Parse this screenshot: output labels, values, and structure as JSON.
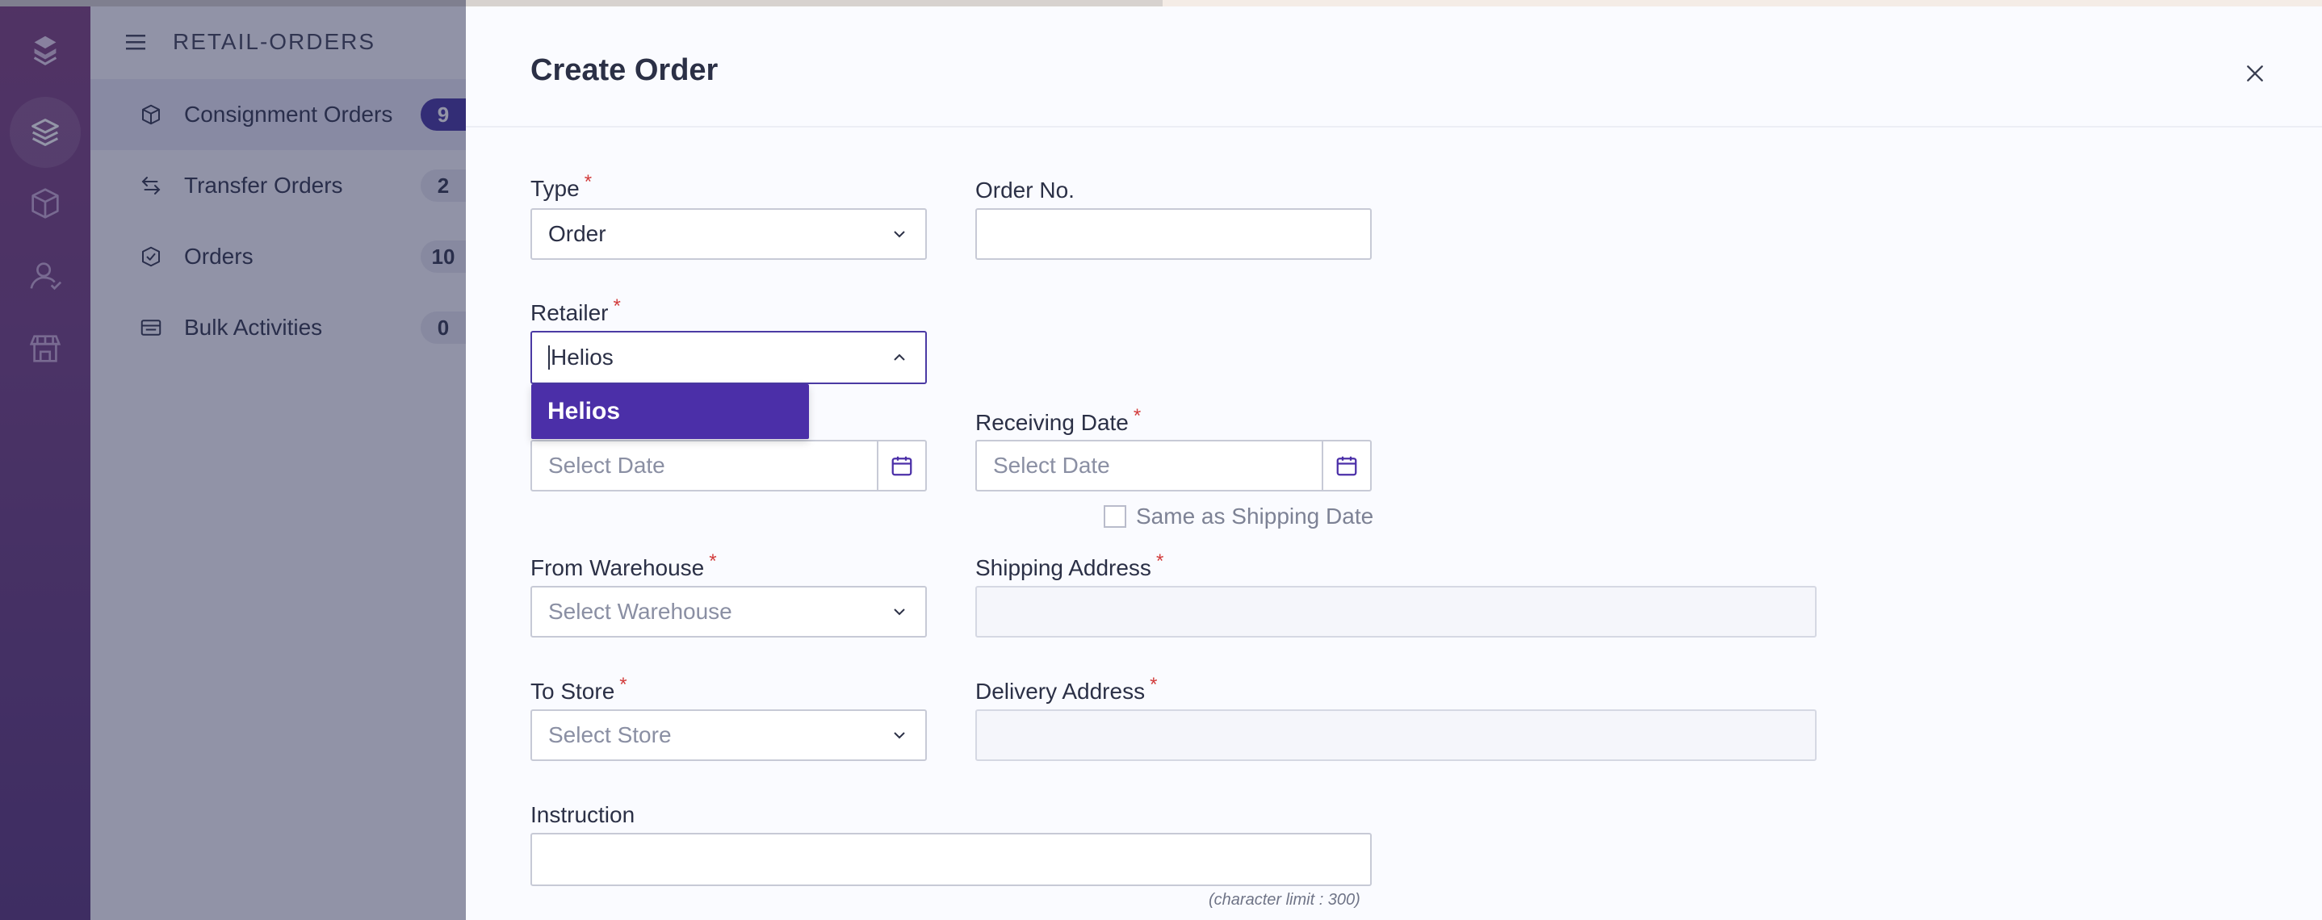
{
  "app": {
    "title": "RETAIL-ORDERS"
  },
  "sidebar": {
    "items": [
      {
        "label": "Consignment Orders",
        "count": "9",
        "icon": "cube-icon",
        "active": true
      },
      {
        "label": "Transfer Orders",
        "count": "2",
        "icon": "transfer-icon"
      },
      {
        "label": "Orders",
        "count": "10",
        "icon": "check-shield-icon"
      },
      {
        "label": "Bulk Activities",
        "count": "0",
        "icon": "list-icon"
      }
    ]
  },
  "rail": {
    "icons": [
      "logo-icon",
      "layers-icon",
      "cube-icon",
      "user-icon",
      "store-icon"
    ]
  },
  "modal": {
    "title": "Create Order",
    "close_icon": "close-icon",
    "fields": {
      "type": {
        "label": "Type",
        "value": "Order",
        "required": "*"
      },
      "order_no": {
        "label": "Order No.",
        "value": ""
      },
      "retailer": {
        "label": "Retailer",
        "value": "Helios",
        "required": "*"
      },
      "retailer_option": "Helios",
      "shipping_date": {
        "placeholder": "Select Date"
      },
      "receiving_date": {
        "label": "Receiving Date",
        "placeholder": "Select Date",
        "required": "*"
      },
      "same_as_shipping": "Same as Shipping Date",
      "from_warehouse": {
        "label": "From Warehouse",
        "placeholder": "Select Warehouse",
        "required": "*"
      },
      "shipping_address": {
        "label": "Shipping Address",
        "required": "*"
      },
      "to_store": {
        "label": "To Store",
        "placeholder": "Select Store",
        "required": "*"
      },
      "delivery_address": {
        "label": "Delivery Address",
        "required": "*"
      },
      "instruction": {
        "label": "Instruction",
        "char_limit": "(character limit : 300)"
      }
    }
  },
  "colors": {
    "accent": "#4b2fa8",
    "badge": "#3f2e9d",
    "required": "#d23c3c"
  }
}
